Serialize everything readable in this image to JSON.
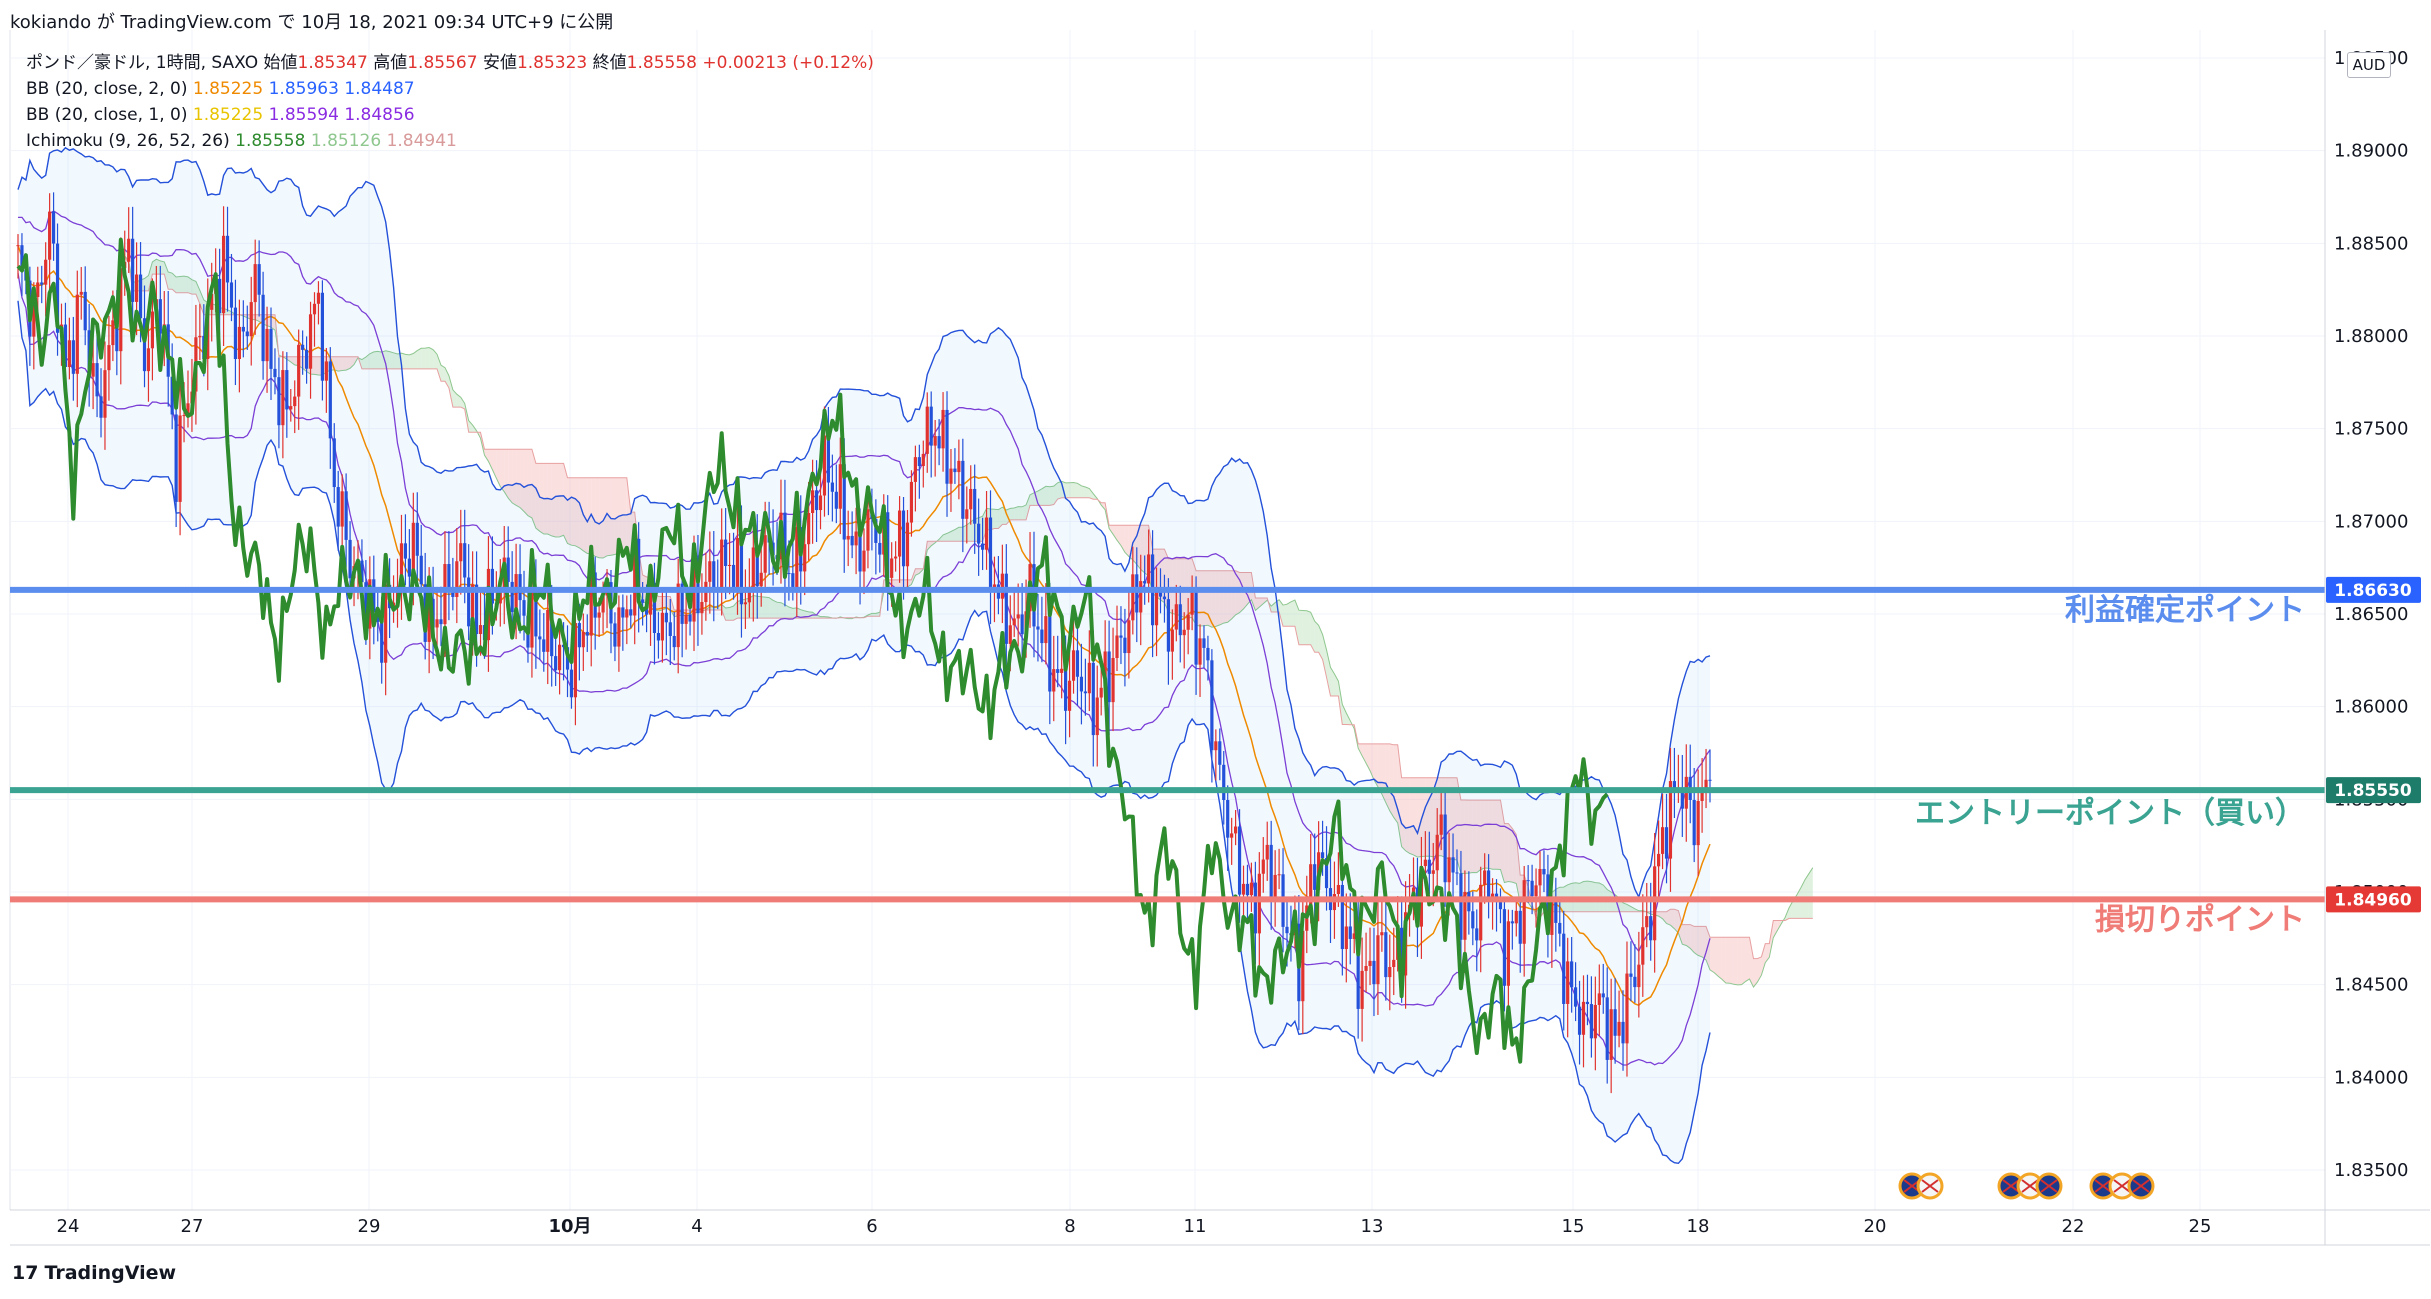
{
  "header": {
    "text": "kokiando が TradingView.com で 10月 18, 2021 09:34 UTC+9 に公開"
  },
  "legend": {
    "main": {
      "label": "ポンド／豪ドル, 1時間, SAXO",
      "open_label": "始値",
      "open": "1.85347",
      "high_label": "高値",
      "high": "1.85567",
      "low_label": "安値",
      "low": "1.85323",
      "close_label": "終値",
      "close": "1.85558",
      "change": "+0.00213 (+0.12%)"
    },
    "bb1": {
      "label": "BB (20, close, 2, 0)",
      "v1": "1.85225",
      "v2": "1.85963",
      "v3": "1.84487"
    },
    "bb2": {
      "label": "BB (20, close, 1, 0)",
      "v1": "1.85225",
      "v2": "1.85594",
      "v3": "1.84856"
    },
    "ichimoku": {
      "label": "Ichimoku (9, 26, 52, 26)",
      "v1": "1.85558",
      "v2": "1.85126",
      "v3": "1.84941"
    }
  },
  "currency_button": "AUD",
  "footer": {
    "brand": "TradingView"
  },
  "colors": {
    "profit": "#5b8def",
    "entry": "#3aa391",
    "stop": "#f07c77",
    "bull": "#e0332f",
    "bear": "#2451d9"
  },
  "chart_data": {
    "type": "candlestick",
    "title": "",
    "ylim": [
      1.83,
      1.895
    ],
    "y_ticks": [
      "1.83500",
      "1.84000",
      "1.84500",
      "1.85000",
      "1.85500",
      "1.86000",
      "1.86500",
      "1.87000",
      "1.87500",
      "1.88000",
      "1.88500",
      "1.89000",
      "1.89500"
    ],
    "x_ticks": [
      "24",
      "27",
      "29",
      "10月",
      "4",
      "6",
      "8",
      "11",
      "13",
      "15",
      "18",
      "20",
      "22",
      "25"
    ],
    "horizontal_lines": [
      {
        "label": "利益確定ポイント",
        "price": "1.86630",
        "color": "#5b8def"
      },
      {
        "label": "エントリーポイント（買い）",
        "price": "1.85550",
        "color": "#3aa391"
      },
      {
        "label": "損切りポイント",
        "price": "1.84960",
        "color": "#f07c77"
      }
    ],
    "close_series": [
      1.884,
      1.881,
      1.886,
      1.878,
      1.882,
      1.876,
      1.88,
      1.885,
      1.879,
      1.882,
      1.873,
      1.878,
      1.881,
      1.884,
      1.879,
      1.883,
      1.878,
      1.876,
      1.879,
      1.882,
      1.872,
      1.868,
      1.866,
      1.864,
      1.867,
      1.869,
      1.864,
      1.866,
      1.868,
      1.864,
      1.866,
      1.867,
      1.865,
      1.864,
      1.863,
      1.862,
      1.865,
      1.866,
      1.864,
      1.867,
      1.865,
      1.864,
      1.865,
      1.866,
      1.867,
      1.868,
      1.866,
      1.868,
      1.869,
      1.867,
      1.87,
      1.873,
      1.871,
      1.868,
      1.87,
      1.868,
      1.869,
      1.874,
      1.875,
      1.873,
      1.871,
      1.869,
      1.866,
      1.864,
      1.866,
      1.863,
      1.861,
      1.862,
      1.86,
      1.862,
      1.864,
      1.867,
      1.866,
      1.864,
      1.865,
      1.863,
      1.856,
      1.852,
      1.849,
      1.852,
      1.849,
      1.846,
      1.852,
      1.85,
      1.848,
      1.845,
      1.847,
      1.846,
      1.849,
      1.851,
      1.853,
      1.85,
      1.848,
      1.851,
      1.847,
      1.849,
      1.851,
      1.849,
      1.845,
      1.843,
      1.844,
      1.842,
      1.845,
      1.848,
      1.853,
      1.856,
      1.854,
      1.856
    ]
  }
}
